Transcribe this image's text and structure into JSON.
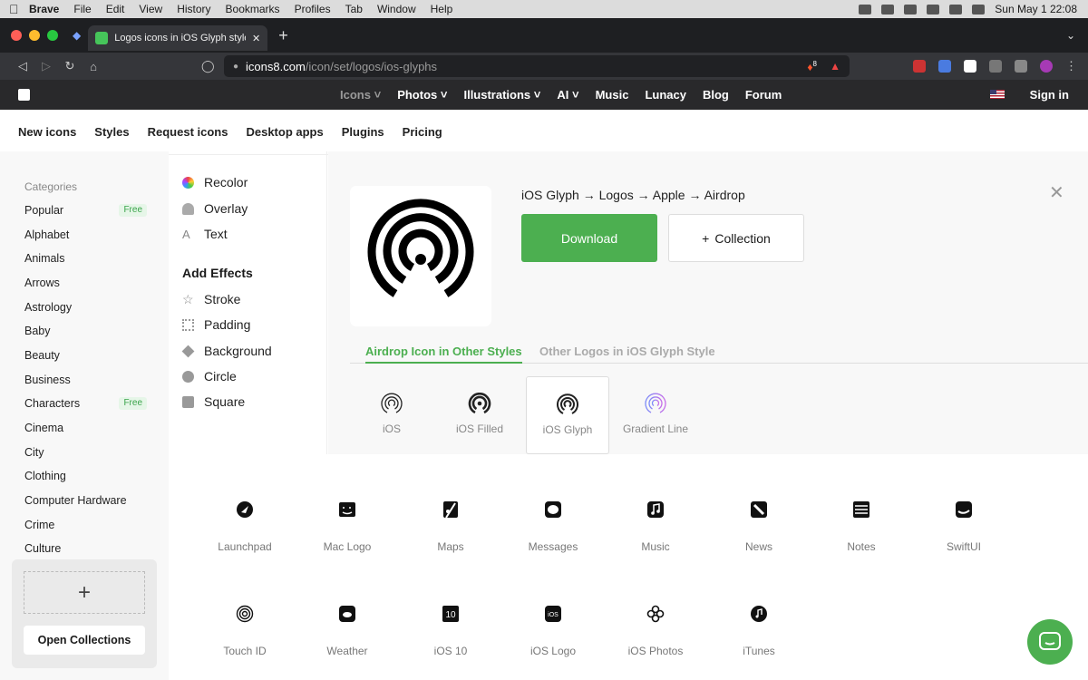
{
  "menubar": {
    "app": "Brave",
    "items": [
      "File",
      "Edit",
      "View",
      "History",
      "Bookmarks",
      "Profiles",
      "Tab",
      "Window",
      "Help"
    ],
    "clock": "Sun May 1  22:08"
  },
  "browser": {
    "tab_title": "Logos icons in iOS Glyph style f",
    "url_domain": "icons8.com",
    "url_path": "/icon/set/logos/ios-glyphs",
    "shield_count": "8"
  },
  "site": {
    "nav": [
      "Icons",
      "Photos",
      "Illustrations",
      "AI",
      "Music",
      "Lunacy",
      "Blog",
      "Forum"
    ],
    "signin": "Sign in"
  },
  "subnav": [
    "New icons",
    "Styles",
    "Request icons",
    "Desktop apps",
    "Plugins",
    "Pricing"
  ],
  "sidebar": {
    "heading": "Categories",
    "free_badge": "Free",
    "items": [
      "Popular",
      "Alphabet",
      "Animals",
      "Arrows",
      "Astrology",
      "Baby",
      "Beauty",
      "Business",
      "Characters",
      "Cinema",
      "City",
      "Clothing",
      "Computer Hardware",
      "Crime",
      "Culture"
    ],
    "open_collections": "Open Collections"
  },
  "effects": {
    "top": [
      "Recolor",
      "Overlay",
      "Text"
    ],
    "heading": "Add Effects",
    "items": [
      "Stroke",
      "Padding",
      "Background",
      "Circle",
      "Square"
    ]
  },
  "detail": {
    "crumbs": [
      "iOS Glyph",
      "Logos",
      "Apple",
      "Airdrop"
    ],
    "download": "Download",
    "collection": "Collection",
    "tab_active": "Airdrop Icon in Other Styles",
    "tab_other": "Other Logos in iOS Glyph Style",
    "styles": [
      "iOS",
      "iOS Filled",
      "iOS Glyph",
      "Gradient Line"
    ]
  },
  "icons": [
    "Launchpad",
    "Mac Logo",
    "Maps",
    "Messages",
    "Music",
    "News",
    "Notes",
    "SwiftUI",
    "Touch ID",
    "Weather",
    "iOS 10",
    "iOS Logo",
    "iOS Photos",
    "iTunes"
  ],
  "colors": {
    "accent": "#4caf50",
    "nav_bg": "#29292b"
  }
}
